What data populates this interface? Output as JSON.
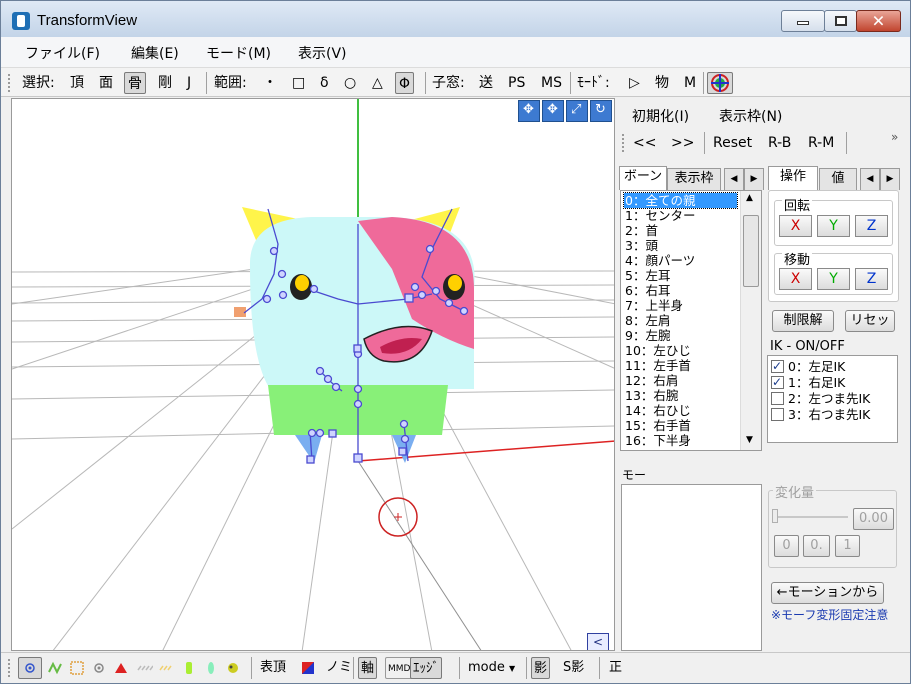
{
  "window": {
    "title": "TransformView"
  },
  "menu": {
    "file": "ファイル(F)",
    "edit": "編集(E)",
    "mode": "モード(M)",
    "view": "表示(V)"
  },
  "toolbar": {
    "select_label": "選択:",
    "vertex": "頂",
    "face": "面",
    "bone": "骨",
    "rigid": "剛",
    "joint": "J",
    "range_label": "範囲:",
    "range_point": "・",
    "range_rect": "□",
    "range_delta": "δ",
    "range_circle": "○",
    "range_triangle": "△",
    "range_phi": "Φ",
    "child_window_label": "子窓:",
    "send": "送",
    "ps": "PS",
    "ms": "MS",
    "mode_label": "ﾓｰﾄﾞ:",
    "play_icon": "▷",
    "physics": "物",
    "m": "M"
  },
  "viewport": {
    "back_button": "<"
  },
  "right_panel": {
    "menu_init": "初期化(I)",
    "menu_frame": "表示枠(N)",
    "nav_prev": "<<",
    "nav_next": ">>",
    "reset": "Reset",
    "rb": "R-B",
    "rm": "R-M",
    "overflow": "»",
    "tabs_left": {
      "bone": "ボーン",
      "frame": "表示枠"
    },
    "tabs_right": {
      "operate": "操作",
      "value": "値"
    },
    "bones": [
      "0：全ての親",
      "1：センター",
      "2：首",
      "3：頭",
      "4：顔パーツ",
      "5：左耳",
      "6：右耳",
      "7：上半身",
      "8：左肩",
      "9：左腕",
      "10：左ひじ",
      "11：左手首",
      "12：右肩",
      "13：右腕",
      "14：右ひじ",
      "15：右手首",
      "16：下半身"
    ],
    "rotate_label": "回転",
    "move_label": "移動",
    "axes": [
      "X",
      "Y",
      "Z"
    ],
    "unlimit": "制限解",
    "reset_jp": "リセッ",
    "ik_label": "IK - ON/OFF",
    "ik_items": [
      {
        "label": "0：左足IK",
        "checked": true
      },
      {
        "label": "1：右足IK",
        "checked": true
      },
      {
        "label": "2：左つま先IK",
        "checked": false
      },
      {
        "label": "3：右つま先IK",
        "checked": false
      }
    ],
    "morph_label": "モー",
    "change_label": "変化量",
    "change_value": "0.00",
    "quick_values": [
      "0",
      "0.",
      "1"
    ],
    "from_motion": "←モーションから",
    "note": "※モーフ変形固定注意"
  },
  "statusbar": {
    "surface_vertex": "表頂",
    "nomi": "ノミ",
    "axis": "軸",
    "mmd": "MMD",
    "edge": "ｴｯｼﾞ",
    "mode": "mode",
    "shadow": "影",
    "s_shadow": "S影",
    "front": "正"
  },
  "colors": {
    "title_bar": "#c3d4e8",
    "selection": "#3399ff",
    "axis_x": "#cc0000",
    "axis_y": "#00aa00",
    "axis_z": "#0033cc",
    "bone": "#4a4ad0"
  }
}
